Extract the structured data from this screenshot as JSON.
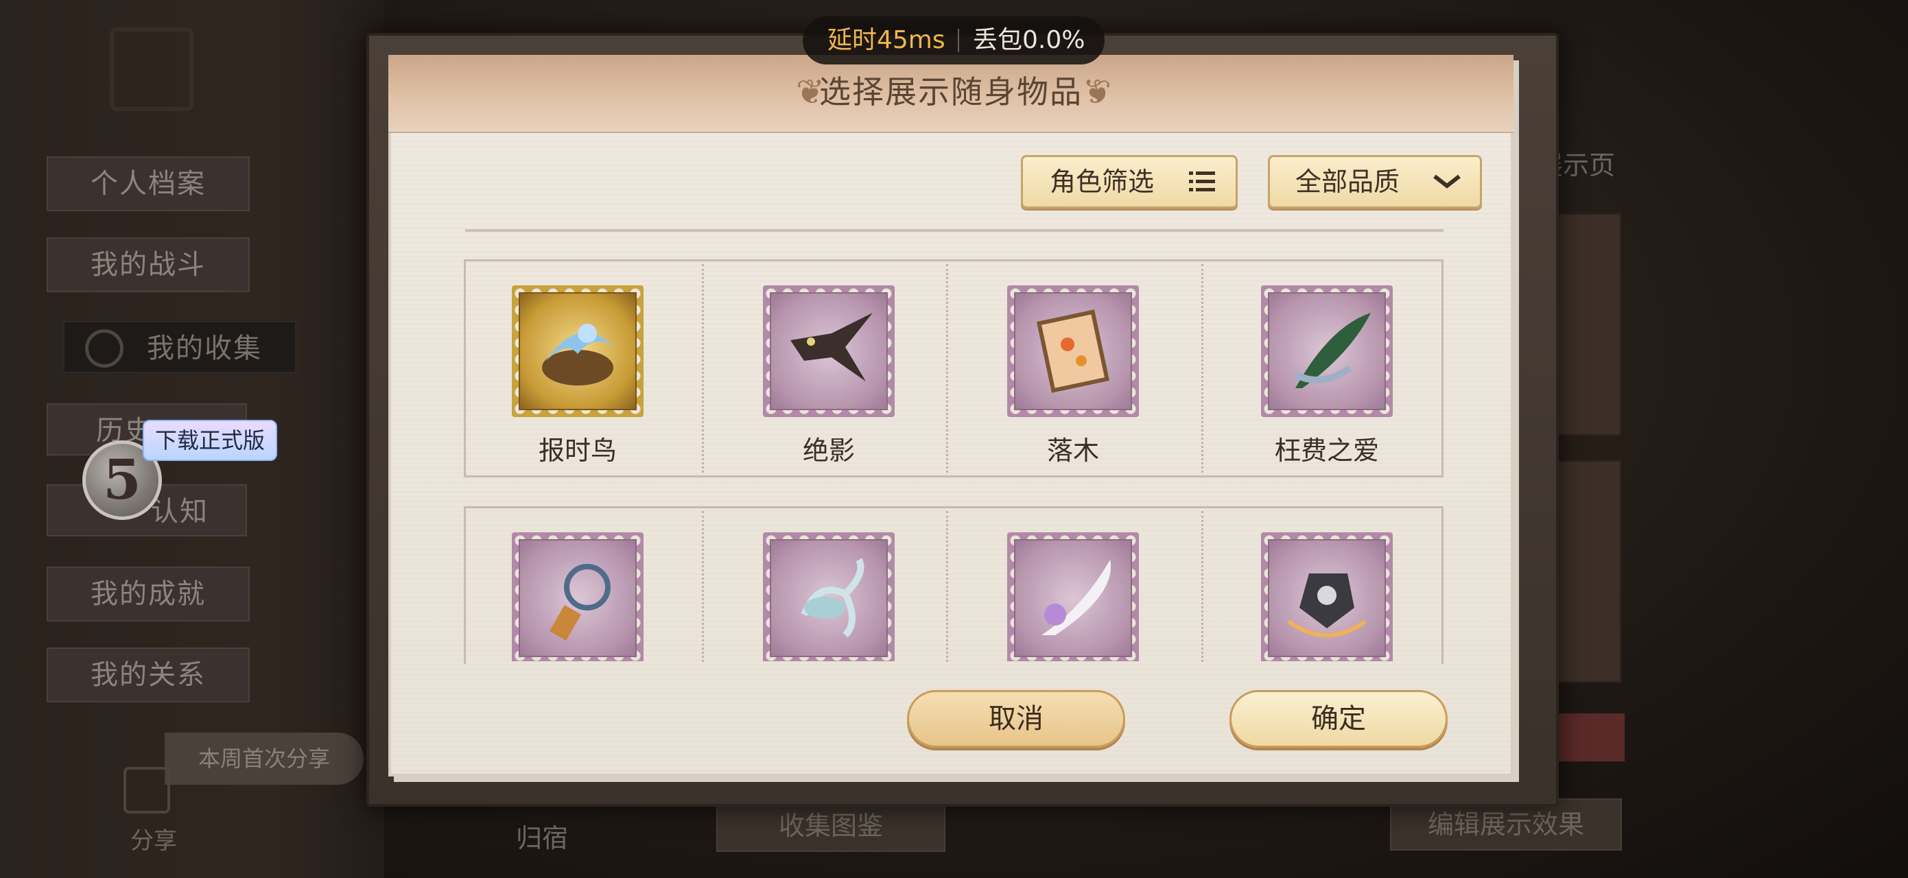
{
  "network": {
    "latency": "延时45ms",
    "packet_loss": "丢包0.0%"
  },
  "background": {
    "menu": [
      "个人档案",
      "我的战斗",
      "我的收集",
      "历史",
      "认知",
      "我的成就",
      "我的关系"
    ],
    "download_tip": "下载正式版",
    "float_ball_digit": "5",
    "share_week": "本周首次分享",
    "share_label": "分享",
    "bottom_buttons": [
      "归宿",
      "收集图鉴",
      "编辑展示效果"
    ],
    "right_title": "展示页"
  },
  "dialog": {
    "title": "选择展示随身物品",
    "filter_role": "角色筛选",
    "filter_quality": "全部品质",
    "items": [
      {
        "name": "报时鸟",
        "rarity": "gold"
      },
      {
        "name": "绝影",
        "rarity": "purple"
      },
      {
        "name": "落木",
        "rarity": "purple"
      },
      {
        "name": "枉费之爱",
        "rarity": "purple"
      },
      {
        "name": "",
        "rarity": "purple"
      },
      {
        "name": "",
        "rarity": "purple"
      },
      {
        "name": "",
        "rarity": "purple"
      },
      {
        "name": "",
        "rarity": "purple"
      }
    ],
    "cancel": "取消",
    "confirm": "确定"
  },
  "colors": {
    "latency_text": "#f1b64b",
    "gold_stamp": "#c8a23c",
    "purple_stamp": "#b08aa6",
    "button_gold": "#e8c48a"
  }
}
